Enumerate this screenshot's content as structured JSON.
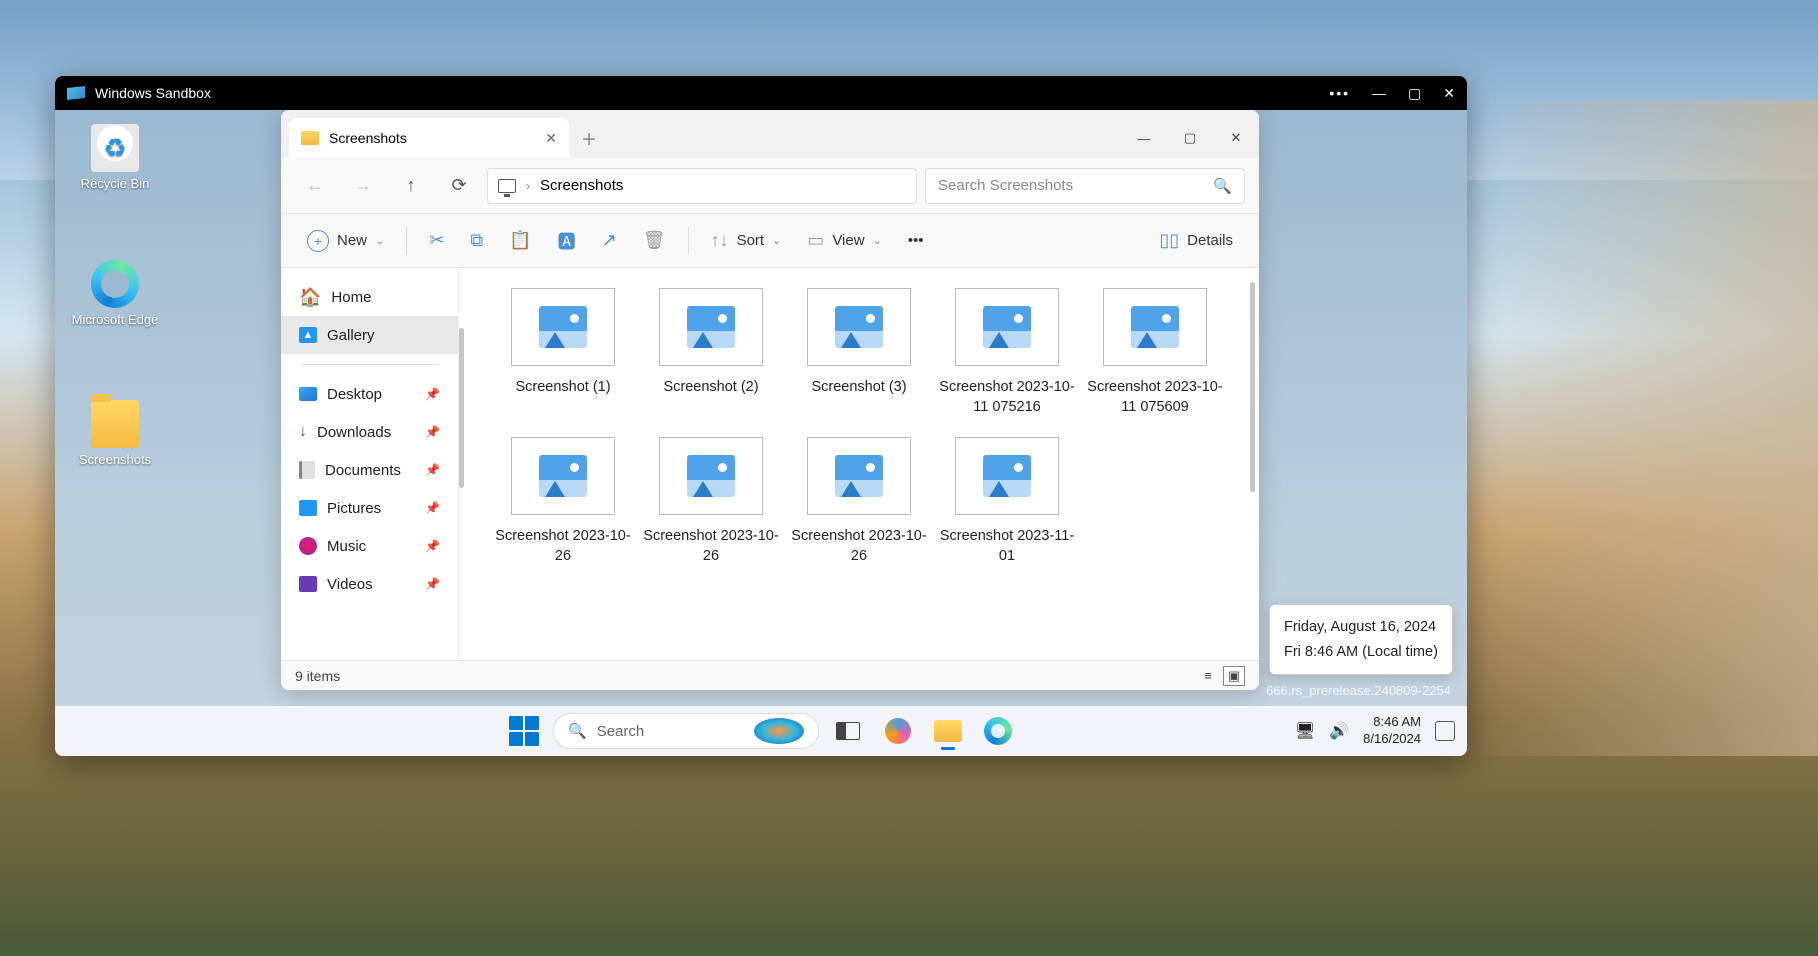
{
  "sandbox": {
    "title": "Windows Sandbox"
  },
  "desktop_icons": {
    "recycle": "Recycle Bin",
    "edge": "Microsoft Edge",
    "screenshots": "Screenshots"
  },
  "explorer": {
    "tab_title": "Screenshots",
    "breadcrumb": "Screenshots",
    "search_placeholder": "Search Screenshots",
    "toolbar": {
      "new": "New",
      "sort": "Sort",
      "view": "View",
      "details": "Details"
    },
    "sidebar": {
      "home": "Home",
      "gallery": "Gallery",
      "desktop": "Desktop",
      "downloads": "Downloads",
      "documents": "Documents",
      "pictures": "Pictures",
      "music": "Music",
      "videos": "Videos"
    },
    "files": [
      "Screenshot (1)",
      "Screenshot (2)",
      "Screenshot (3)",
      "Screenshot 2023-10-11 075216",
      "Screenshot 2023-10-11 075609",
      "Screenshot 2023-10-26",
      "Screenshot 2023-10-26",
      "Screenshot 2023-10-26",
      "Screenshot 2023-11-01"
    ],
    "status": "9 items"
  },
  "tooltip": {
    "date": "Friday, August 16, 2024",
    "time": "Fri 8:46 AM (Local time)"
  },
  "build": "666.rs_prerelease.240809-2254",
  "taskbar": {
    "search": "Search",
    "clock_time": "8:46 AM",
    "clock_date": "8/16/2024"
  }
}
